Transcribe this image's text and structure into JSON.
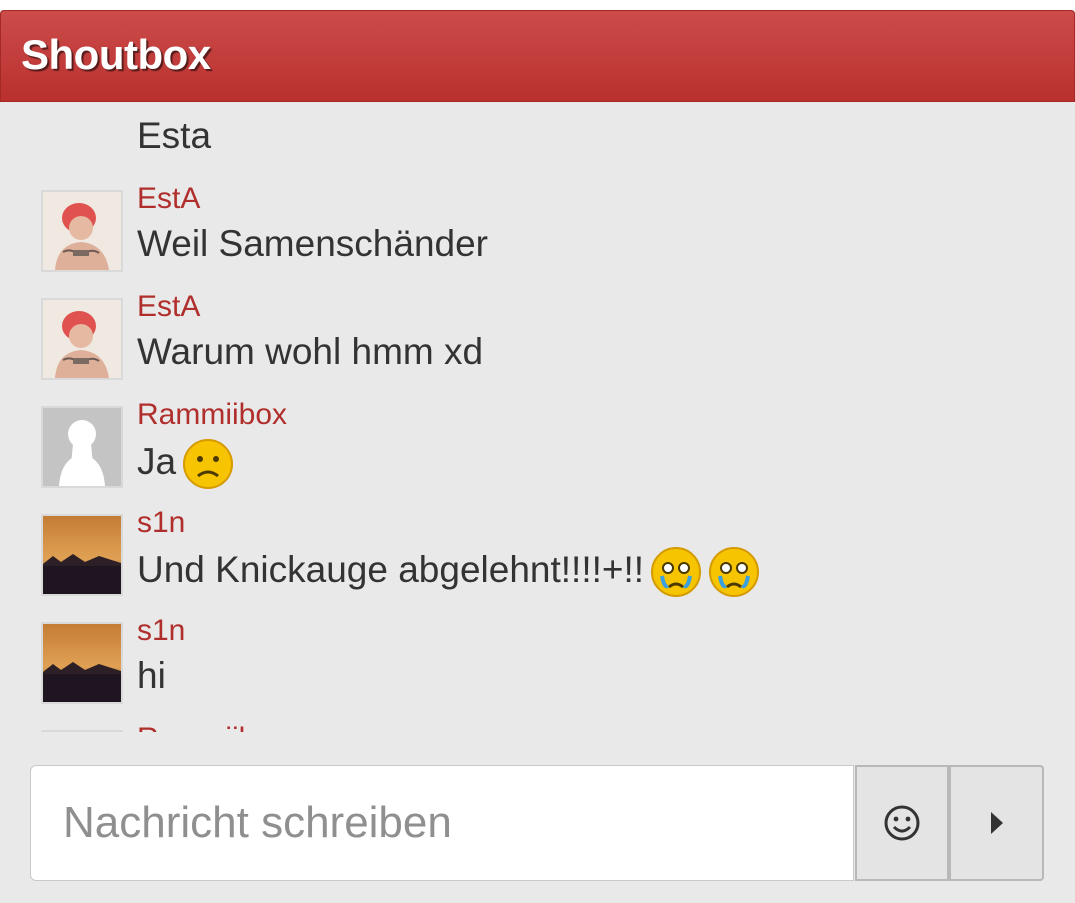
{
  "header": {
    "title": "Shoutbox"
  },
  "messages": [
    {
      "user": "",
      "text": "Esta",
      "avatar": "esta-photo",
      "smileys": []
    },
    {
      "user": "EstA",
      "text": "Weil Samenschänder",
      "avatar": "esta-photo",
      "smileys": []
    },
    {
      "user": "EstA",
      "text": "Warum wohl hmm xd",
      "avatar": "esta-photo",
      "smileys": []
    },
    {
      "user": "Rammiibox",
      "text": "Ja",
      "avatar": "default-silhouette",
      "smileys": [
        "sad-smiley"
      ]
    },
    {
      "user": "s1n",
      "text": "Und Knickauge abgelehnt!!!!+!!",
      "avatar": "sunset-photo",
      "smileys": [
        "crying-smiley",
        "crying-smiley"
      ]
    },
    {
      "user": "s1n",
      "text": "hi",
      "avatar": "sunset-photo",
      "smileys": []
    },
    {
      "user": "Rammiibox",
      "text": "",
      "avatar": "default-silhouette",
      "smileys": []
    }
  ],
  "composer": {
    "placeholder": "Nachricht schreiben",
    "value": "",
    "emoji_button_icon": "smiley-outline-icon",
    "send_button_icon": "caret-right-icon"
  },
  "colors": {
    "header": "#c0392b",
    "username": "#b02f2c",
    "background": "#e9e9e9"
  }
}
